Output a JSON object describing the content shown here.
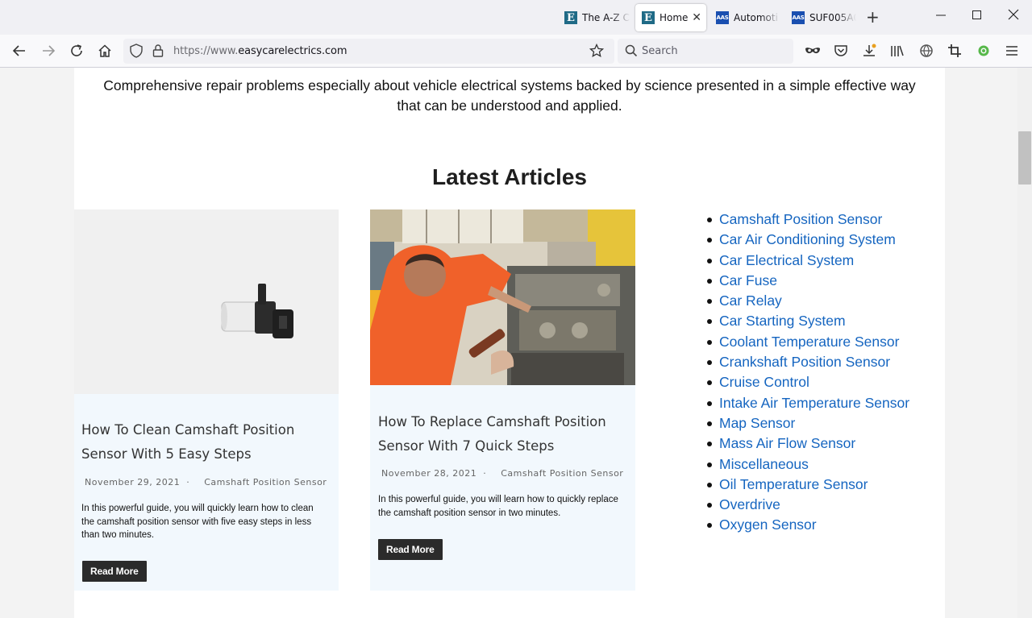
{
  "browser": {
    "tabs": [
      {
        "label": "The A-Z C",
        "favicon": "E"
      },
      {
        "label": "Home",
        "favicon": "E"
      },
      {
        "label": "Automoti",
        "favicon": "AAS"
      },
      {
        "label": "SUF005A0",
        "favicon": "AAS"
      }
    ],
    "address": {
      "scheme": "https://www.",
      "host": "easycarelectrics.com"
    },
    "search_placeholder": "Search",
    "toolbar_icons": [
      "mask-icon",
      "pocket-icon",
      "download-icon",
      "library-icon",
      "extension-globe-icon",
      "screenshot-icon",
      "sync-badge-icon",
      "menu-icon"
    ]
  },
  "page": {
    "intro": "Comprehensive repair problems especially about vehicle electrical systems backed by science presented in a simple effective way that can be understood and applied.",
    "section_title": "Latest Articles",
    "articles": [
      {
        "title": "How To Clean Camshaft Position Sensor With 5 Easy Steps",
        "date": "November 29, 2021",
        "separator": "·",
        "category": "Camshaft Position Sensor",
        "excerpt": "In this powerful guide, you will quickly learn how to clean the camshaft position sensor with five easy steps in less than two minutes.",
        "button": "Read More"
      },
      {
        "title": "How To Replace Camshaft Position Sensor With 7 Quick Steps",
        "date": "November 28, 2021",
        "separator": "·",
        "category": "Camshaft Position Sensor",
        "excerpt": "In this powerful guide, you will learn how to quickly replace the camshaft position sensor in two minutes.",
        "button": "Read More"
      }
    ],
    "categories": [
      "Camshaft Position Sensor",
      "Car Air Conditioning System",
      "Car Electrical System",
      "Car Fuse",
      "Car Relay",
      "Car Starting System",
      "Coolant Temperature Sensor",
      "Crankshaft Position Sensor",
      "Cruise Control",
      "Intake Air Temperature Sensor",
      "Map Sensor",
      "Mass Air Flow Sensor",
      "Miscellaneous",
      "Oil Temperature Sensor",
      "Overdrive",
      "Oxygen Sensor"
    ],
    "link_color": "#1565c0"
  }
}
